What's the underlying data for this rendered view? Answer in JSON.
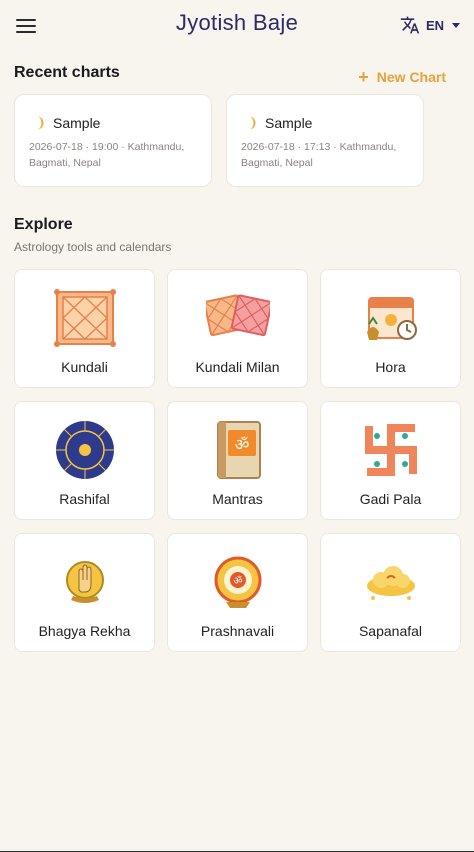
{
  "header": {
    "title": "Jyotish Baje",
    "language": "EN"
  },
  "recent": {
    "title": "Recent charts",
    "new_chart_label": "New Chart",
    "charts": [
      {
        "name": "Sample",
        "meta": "2026-07-18 · 19:00 · Kathmandu, Bagmati, Nepal"
      },
      {
        "name": "Sample",
        "meta": "2026-07-18 · 17:13 · Kathmandu, Bagmati, Nepal"
      }
    ]
  },
  "explore": {
    "title": "Explore",
    "subtitle": "Astrology tools and calendars",
    "tools": [
      {
        "label": "Kundali",
        "icon": "kundali-chart-icon"
      },
      {
        "label": "Kundali Milan",
        "icon": "kundali-match-icon"
      },
      {
        "label": "Hora",
        "icon": "hora-calendar-icon"
      },
      {
        "label": "Rashifal",
        "icon": "zodiac-wheel-icon"
      },
      {
        "label": "Mantras",
        "icon": "om-book-icon"
      },
      {
        "label": "Gadi Pala",
        "icon": "swastika-icon"
      },
      {
        "label": "Bhagya Rekha",
        "icon": "palm-icon"
      },
      {
        "label": "Prashnavali",
        "icon": "om-wheel-icon"
      },
      {
        "label": "Sapanafal",
        "icon": "dream-cloud-icon"
      }
    ]
  },
  "colors": {
    "accent": "#e6a23c",
    "title": "#2d2a66",
    "background": "#f8f4ee"
  }
}
